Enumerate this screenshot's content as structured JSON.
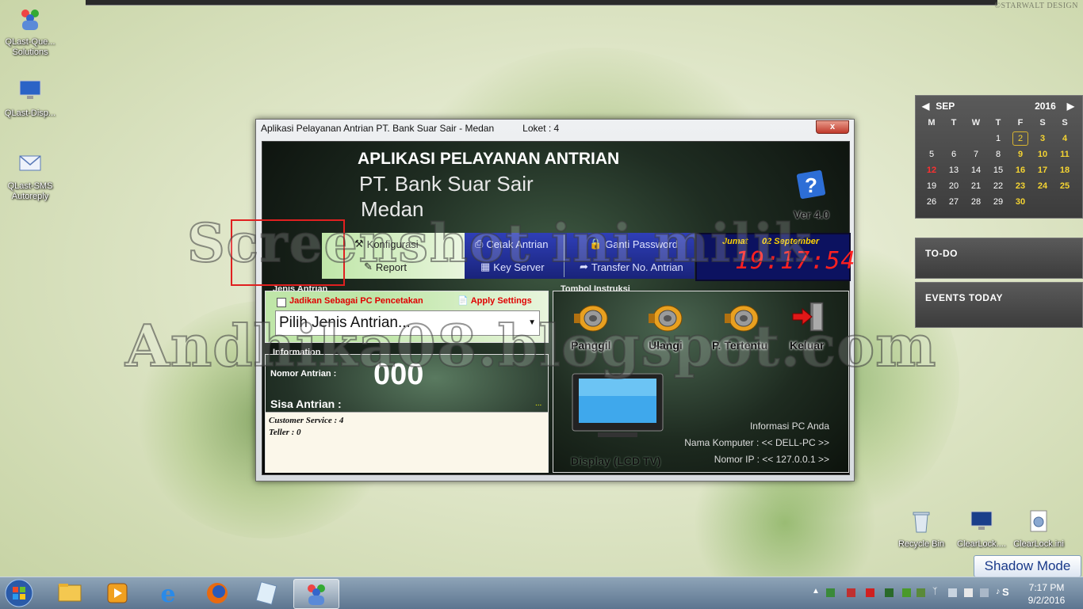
{
  "desktop": {
    "brand": "©STARWALT DESIGN",
    "icons_left": [
      {
        "label": "QLast-Queue\nSolutions",
        "display": "QLast-Que...\nSolutions"
      },
      {
        "label": "QLast-Disp...",
        "display": "QLast-Disp..."
      },
      {
        "label": "QLast-SMS\nAutoreply",
        "display": "QLast-SMS\nAutoreply"
      }
    ],
    "icons_right": [
      "Recycle Bin",
      "ClearLock....",
      "ClearLock.ini"
    ],
    "shadow_mode": "Shadow Mode"
  },
  "calendar": {
    "month": "SEP",
    "year": "2016",
    "weekdays": [
      "M",
      "T",
      "W",
      "T",
      "F",
      "S",
      "S"
    ],
    "weeks": [
      [
        "",
        "",
        "",
        "1",
        "2",
        "3",
        "4"
      ],
      [
        "5",
        "6",
        "7",
        "8",
        "9",
        "10",
        "11"
      ],
      [
        "12",
        "13",
        "14",
        "15",
        "16",
        "17",
        "18"
      ],
      [
        "19",
        "20",
        "21",
        "22",
        "23",
        "24",
        "25"
      ],
      [
        "26",
        "27",
        "28",
        "29",
        "30",
        "",
        ""
      ]
    ],
    "today": "2",
    "holiday": "12"
  },
  "gadgets": {
    "todo": "TO-DO",
    "events": "EVENTS TODAY"
  },
  "window": {
    "title": "Aplikasi Pelayanan Antrian PT. Bank Suar Sair - Medan",
    "loket": "Loket : 4",
    "close": "x",
    "app_title": "APLIKASI PELAYANAN ANTRIAN",
    "bank": "PT. Bank Suar Sair",
    "city": "Medan",
    "version": "Ver 4.0",
    "toolbar": {
      "konfigurasi": "Konfigurasi",
      "report": "Report",
      "cetak": "Cetak Antrian",
      "keyserver": "Key Server",
      "ganti": "Ganti Password",
      "transfer": "Transfer No. Antrian"
    },
    "clock": {
      "day": "Jumat",
      "date": "02 September",
      "time": "19:17:54"
    },
    "jenis": {
      "group": "Jenis Antrian",
      "checkbox_label": "Jadikan Sebagai PC Pencetakan",
      "apply": "Apply Settings",
      "select_value": "Pilih Jenis Antrian..."
    },
    "info": {
      "group": "Information",
      "nomor_label": "Nomor Antrian :",
      "nomor_value": "000",
      "sisa_label": "Sisa Antrian :",
      "dots": "...",
      "lines": [
        "Customer Service : 4",
        "Teller : 0"
      ]
    },
    "tombol": {
      "group": "Tombol Instruksi",
      "panggil": "Panggil",
      "ulangi": "Ulangi",
      "tertentu": "P. Tertentu",
      "keluar": "Keluar",
      "display": "Display (LCD TV)",
      "pc_title": "Informasi PC Anda",
      "pc_name": "Nama Komputer : << DELL-PC >>",
      "pc_ip": "Nomor IP : << 127.0.0.1 >>"
    }
  },
  "watermark": {
    "line1": "Screenshot ini milik",
    "line2": "Andhika08.blogspot.com"
  },
  "taskbar": {
    "time": "7:17 PM",
    "date": "9/2/2016"
  }
}
